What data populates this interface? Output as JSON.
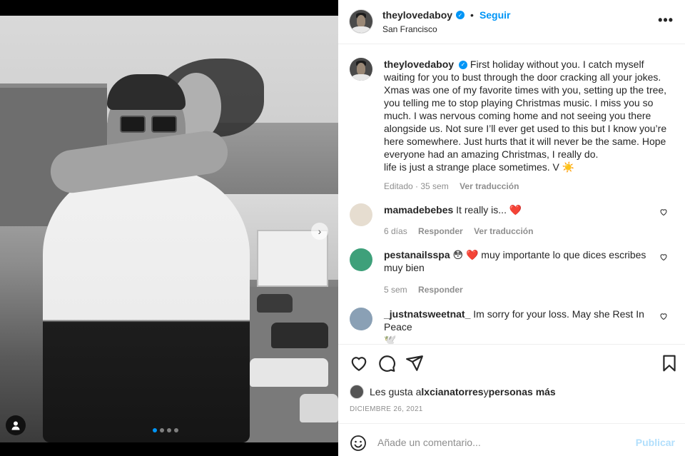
{
  "post": {
    "author": "theylovedaboy",
    "follow_label": "Seguir",
    "dot": "•",
    "location": "San Francisco",
    "more_label": "•••"
  },
  "caption": {
    "username": "theylovedaboy",
    "text": "First holiday without you. I catch myself waiting for you to bust through the door cracking all your jokes. Xmas was one of my favorite times with you, setting up the tree, you telling me to stop playing Christmas music. I miss you so much. I was nervous coming home and not seeing you there alongside us. Not sure I’ll ever get used to this but I know you’re here somewhere. Just hurts that it will never be the same. Hope everyone had an amazing Christmas, I really do.",
    "text2": "life is just a strange place sometimes. V ☀️",
    "time": "Editado · 35 sem",
    "translate": "Ver traducción"
  },
  "comments": [
    {
      "username": "mamadebebes",
      "text": "It really is... ",
      "emoji": "❤️",
      "time": "6 días",
      "reply": "Responder",
      "translate": "Ver traducción"
    },
    {
      "username": "pestanailsspa",
      "prefix": "😳 ❤️",
      "text": " muy importante lo que dices escribes muy bien",
      "time": "5 sem",
      "reply": "Responder"
    },
    {
      "username": "_justnatsweetnat_",
      "text": " Im sorry for your loss. May she Rest In Peace",
      "line2": "🕊️"
    }
  ],
  "likes": {
    "prefix": "Les gusta a ",
    "user": "lxcianatorres",
    "middle": " y ",
    "rest": "personas más"
  },
  "date": "DICIEMBRE 26, 2021",
  "add_comment": {
    "placeholder": "Añade un comentario...",
    "publish": "Publicar"
  },
  "media": {
    "next_arrow": "›",
    "carousel_count": 4,
    "carousel_active": 1
  },
  "colors": {
    "accent": "#0095f6",
    "publish_disabled": "#b2dffc",
    "secondary_text": "#8e8e8e",
    "heart": "#ed4956"
  }
}
